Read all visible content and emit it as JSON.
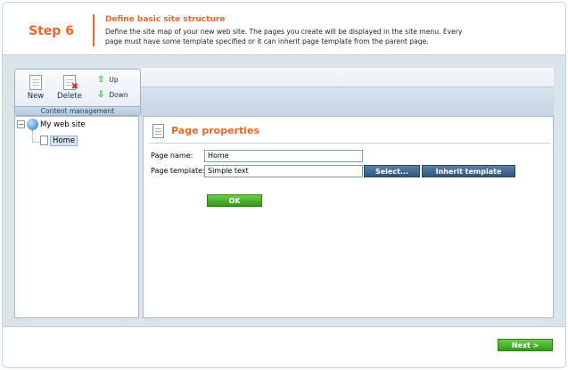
{
  "header": {
    "step": "Step 6",
    "title": "Define basic site structure",
    "description": "Define the site map of your new web site. The pages you create will be displayed in the site menu. Every page must have some template specified or it can inherit page template from the parent page."
  },
  "toolbar": {
    "new_label": "New",
    "delete_label": "Delete",
    "up_label": "Up",
    "down_label": "Down",
    "group_label": "Content management"
  },
  "tree": {
    "root_label": "My web site",
    "toggle": "−",
    "child_label": "Home"
  },
  "properties": {
    "title": "Page properties",
    "page_name_label": "Page name:",
    "page_name_value": "Home",
    "page_template_label": "Page template:",
    "page_template_value": "Simple text",
    "select_button": "Select...",
    "inherit_button": "Inherit template",
    "ok_button": "OK"
  },
  "footer": {
    "next_button": "Next >"
  },
  "colors": {
    "accent": "#f26522",
    "panel_bg": "#dbe3eb",
    "button_blue": "#2e5580",
    "button_green": "#2f9a17"
  }
}
